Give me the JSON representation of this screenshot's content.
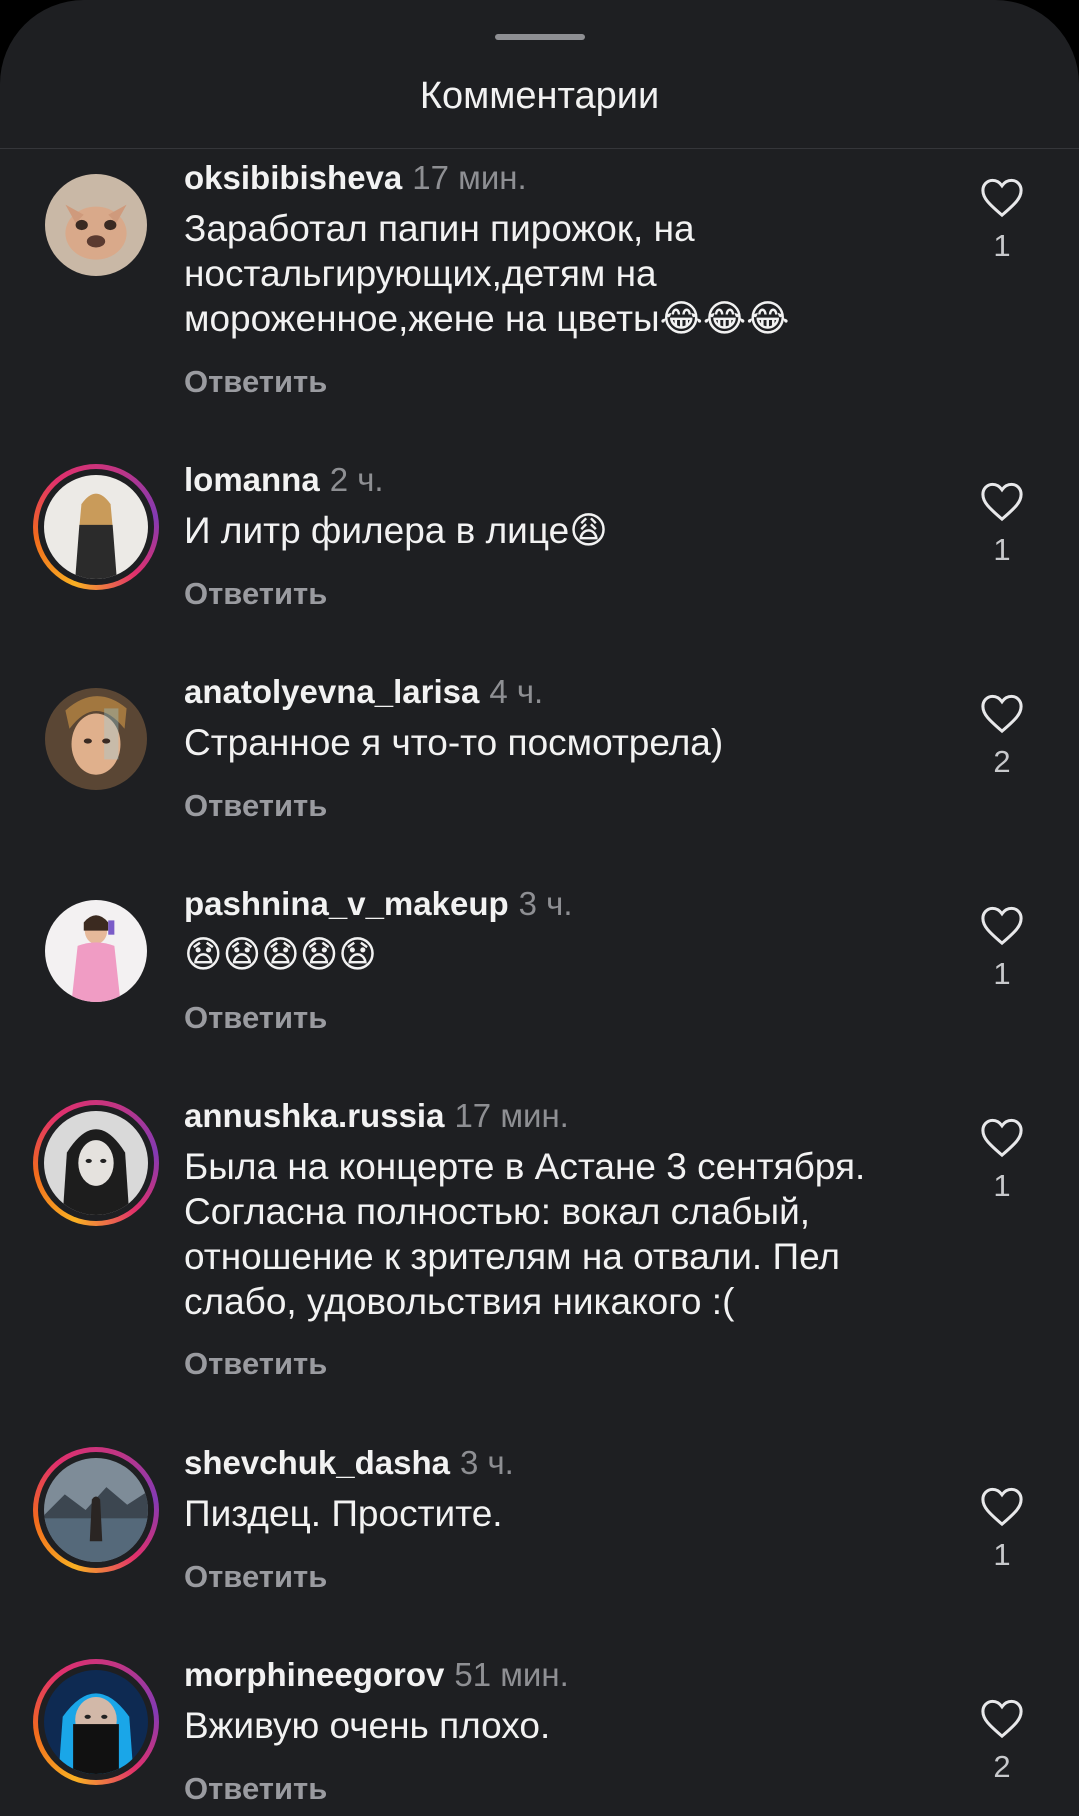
{
  "header": {
    "title": "Комментарии"
  },
  "comments": [
    {
      "username": "oksibibisheva",
      "time": "17 мин.",
      "text": "Заработал папин пирожок, на ностальгирующих,детям на мороженное,жене на цветы😂😂😂",
      "reply": "Ответить",
      "likes": "1"
    },
    {
      "username": "lomanna",
      "time": "2 ч.",
      "text": "И литр филера в лице😩",
      "reply": "Ответить",
      "likes": "1"
    },
    {
      "username": "anatolyevna_larisa",
      "time": "4 ч.",
      "text": "Странное я что-то посмотрела)",
      "reply": "Ответить",
      "likes": "2"
    },
    {
      "username": "pashnina_v_makeup",
      "time": "3 ч.",
      "text": "😧😧😧😧😧",
      "reply": "Ответить",
      "likes": "1"
    },
    {
      "username": "annushka.russia",
      "time": "17 мин.",
      "text": "Была на концерте в Астане 3 сентября. Согласна полностью: вокал слабый, отношение к зрителям на отвали. Пел слабо, удовольствия никакого :(",
      "reply": "Ответить",
      "likes": "1"
    },
    {
      "username": "shevchuk_dasha",
      "time": "3 ч.",
      "text": "Пиздец. Простите.",
      "reply": "Ответить",
      "likes": "1"
    },
    {
      "username": "morphineegorov",
      "time": "51 мин.",
      "text": "Вживую очень плохо.",
      "reply": "Ответить",
      "likes": "2"
    }
  ],
  "icons": {
    "like": "heart-outline-icon"
  },
  "colors": {
    "background": "#1e1f22",
    "text": "#f2f2f2",
    "muted": "#8e8f93",
    "story_ring": "#e1306c"
  }
}
